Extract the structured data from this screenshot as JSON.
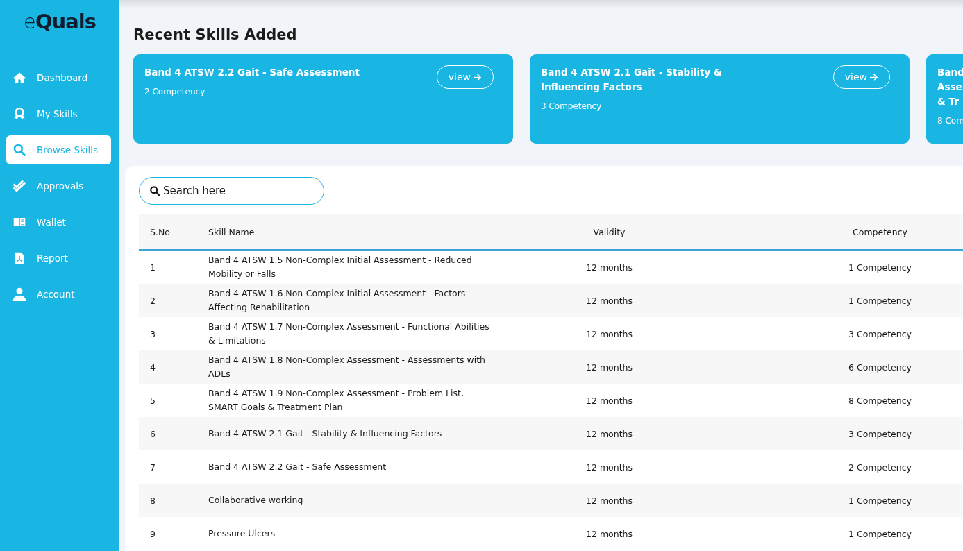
{
  "logo": {
    "prefix": "e",
    "main": "Quals"
  },
  "sidebar": {
    "items": [
      {
        "label": "Dashboard",
        "selected": false
      },
      {
        "label": "My Skills",
        "selected": false
      },
      {
        "label": "Browse Skills",
        "selected": true
      },
      {
        "label": "Approvals",
        "selected": false
      },
      {
        "label": "Wallet",
        "selected": false
      },
      {
        "label": "Report",
        "selected": false
      },
      {
        "label": "Account",
        "selected": false
      }
    ]
  },
  "recent": {
    "title": "Recent Skills Added",
    "cards": [
      {
        "title_lines": [
          "Band 4 ATSW 2.2 Gait - Safe Assessment"
        ],
        "count": "2 Competency",
        "button": "view"
      },
      {
        "title_lines": [
          "Band 4 ATSW 2.1 Gait - Stability &",
          "Influencing Factors"
        ],
        "count": "3 Competency",
        "button": "view"
      },
      {
        "title_lines": [
          "Band",
          "Asse",
          "& Tr"
        ],
        "count": "8 Com"
      }
    ]
  },
  "search": {
    "placeholder": "Search here"
  },
  "table": {
    "columns": [
      "S.No",
      "Skill Name",
      "Validity",
      "Competency"
    ],
    "rows": [
      [
        "1",
        "Band 4 ATSW 1.5 Non-Complex Initial Assessment - Reduced Mobility or Falls",
        "12 months",
        "1 Competency"
      ],
      [
        "2",
        "Band 4 ATSW 1.6 Non-Complex Initial Assessment - Factors Affecting Rehabilitation",
        "12 months",
        "1 Competency"
      ],
      [
        "3",
        "Band 4 ATSW 1.7 Non-Complex Assessment - Functional Abilities & Limitations",
        "12 months",
        "3 Competency"
      ],
      [
        "4",
        "Band 4 ATSW 1.8 Non-Complex Assessment - Assessments with ADLs",
        "12 months",
        "6 Competency"
      ],
      [
        "5",
        "Band 4 ATSW 1.9 Non-Complex Assessment - Problem List, SMART Goals & Treatment Plan",
        "12 months",
        "8 Competency"
      ],
      [
        "6",
        "Band 4 ATSW 2.1 Gait - Stability & Influencing Factors",
        "12 months",
        "3 Competency"
      ],
      [
        "7",
        "Band 4 ATSW 2.2 Gait - Safe Assessment",
        "12 months",
        "2 Competency"
      ],
      [
        "8",
        "Collaborative working",
        "12 months",
        "1 Competency"
      ],
      [
        "9",
        "Pressure Ulcers",
        "12 months",
        "1 Competency"
      ]
    ]
  }
}
